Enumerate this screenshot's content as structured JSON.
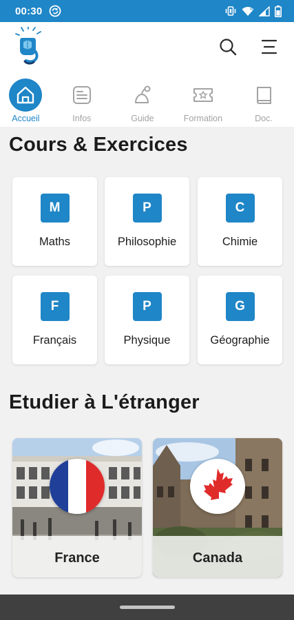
{
  "status_bar": {
    "time": "00:30",
    "icons": [
      "sync-icon",
      "vibrate-icon",
      "wifi-icon",
      "signal-icon",
      "battery-icon"
    ]
  },
  "header": {
    "logo": "app-logo",
    "icons": [
      "search-icon",
      "menu-icon"
    ]
  },
  "nav": {
    "items": [
      {
        "label": "Accueil",
        "icon": "home-icon",
        "active": true
      },
      {
        "label": "Infos",
        "icon": "news-icon",
        "active": false
      },
      {
        "label": "Guide",
        "icon": "guide-icon",
        "active": false
      },
      {
        "label": "Formation",
        "icon": "ticket-icon",
        "active": false
      },
      {
        "label": "Doc.",
        "icon": "book-icon",
        "active": false
      }
    ]
  },
  "cours": {
    "title": "Cours & Exercices",
    "subjects": [
      {
        "letter": "M",
        "name": "Maths"
      },
      {
        "letter": "P",
        "name": "Philosophie"
      },
      {
        "letter": "C",
        "name": "Chimie"
      },
      {
        "letter": "F",
        "name": "Français"
      },
      {
        "letter": "P",
        "name": "Physique"
      },
      {
        "letter": "G",
        "name": "Géographie"
      }
    ]
  },
  "etranger": {
    "title": "Etudier à L'étranger",
    "countries": [
      {
        "name": "France",
        "flag": "france-flag"
      },
      {
        "name": "Canada",
        "flag": "canada-flag"
      }
    ]
  },
  "colors": {
    "accent": "#1f86c7",
    "inactive": "#a3a3a3",
    "background": "#f1f1f1"
  }
}
